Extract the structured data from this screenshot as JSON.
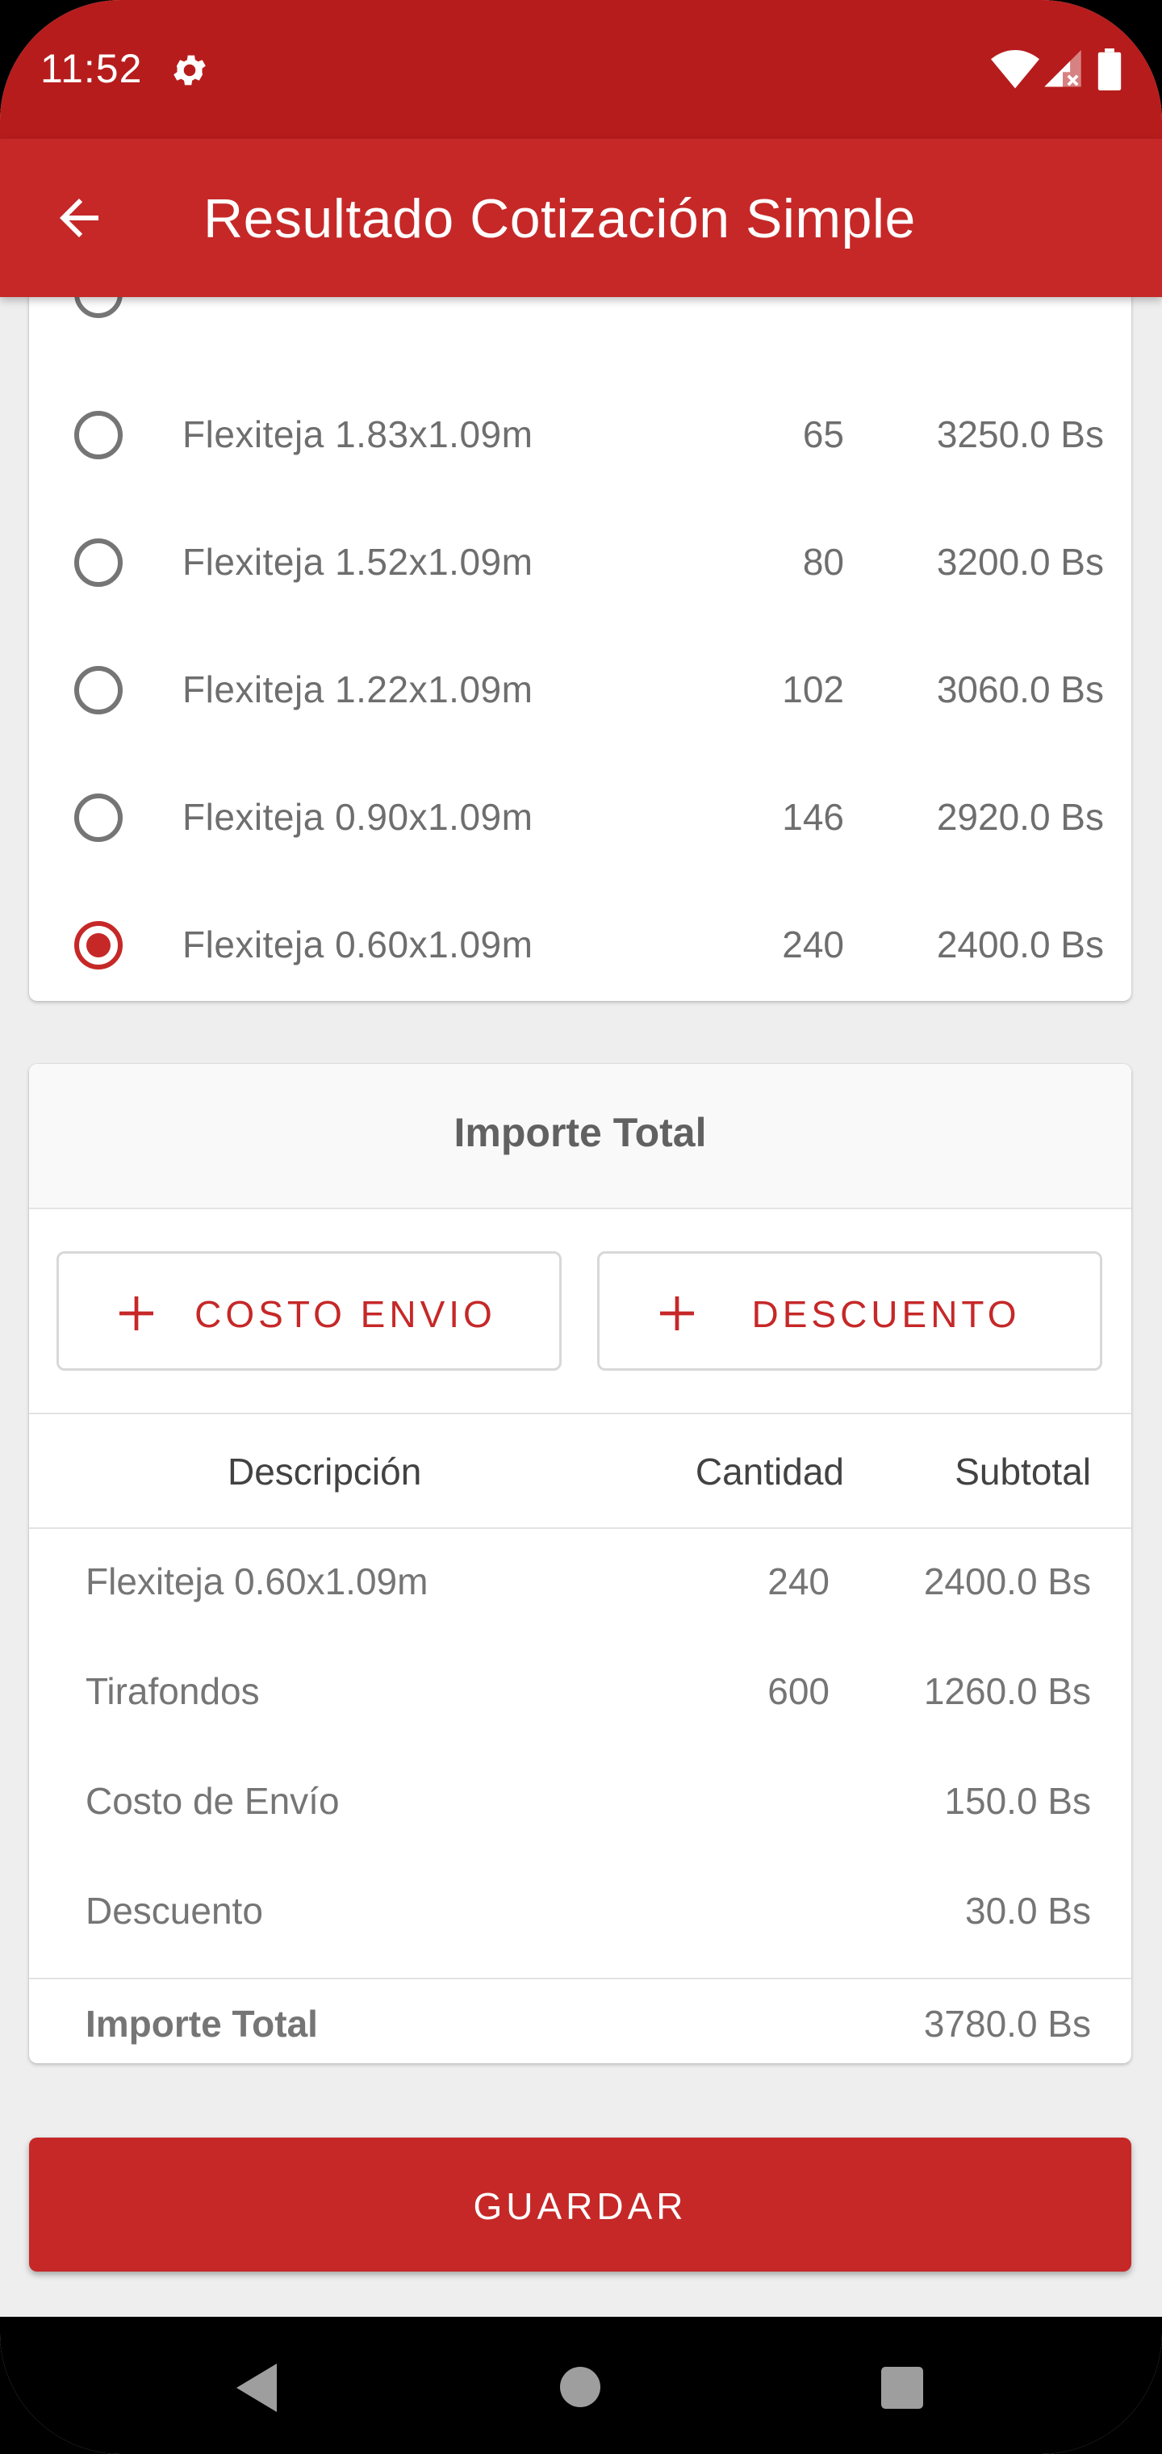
{
  "status_bar": {
    "time": "11:52",
    "icons": [
      "settings-icon",
      "wifi-icon",
      "signal-icon",
      "battery-icon"
    ]
  },
  "app_bar": {
    "title": "Resultado Cotización Simple",
    "back_icon": "arrow-back-icon"
  },
  "options": [
    {
      "name": "Flexiteja 1.83x1.09m",
      "qty": "65",
      "price": "3250.0 Bs",
      "selected": false
    },
    {
      "name": "Flexiteja 1.52x1.09m",
      "qty": "80",
      "price": "3200.0 Bs",
      "selected": false
    },
    {
      "name": "Flexiteja 1.22x1.09m",
      "qty": "102",
      "price": "3060.0 Bs",
      "selected": false
    },
    {
      "name": "Flexiteja 0.90x1.09m",
      "qty": "146",
      "price": "2920.0 Bs",
      "selected": false
    },
    {
      "name": "Flexiteja 0.60x1.09m",
      "qty": "240",
      "price": "2400.0 Bs",
      "selected": true
    }
  ],
  "total_card": {
    "title": "Importe Total",
    "add_shipping_label": "COSTO ENVIO",
    "add_discount_label": "DESCUENTO",
    "table_headers": {
      "description": "Descripción",
      "quantity": "Cantidad",
      "subtotal": "Subtotal"
    },
    "rows": [
      {
        "description": "Flexiteja 0.60x1.09m",
        "quantity": "240",
        "subtotal": "2400.0 Bs"
      },
      {
        "description": "Tirafondos",
        "quantity": "600",
        "subtotal": "1260.0 Bs"
      },
      {
        "description": "Costo de Envío",
        "quantity": "",
        "subtotal": "150.0 Bs"
      },
      {
        "description": "Descuento",
        "quantity": "",
        "subtotal": "30.0 Bs"
      }
    ],
    "total_label": "Importe Total",
    "total_value": "3780.0 Bs"
  },
  "save_button_label": "GUARDAR",
  "colors": {
    "primary": "#C62828",
    "primary_dark": "#B71C1C",
    "background": "#EEEEEE"
  }
}
